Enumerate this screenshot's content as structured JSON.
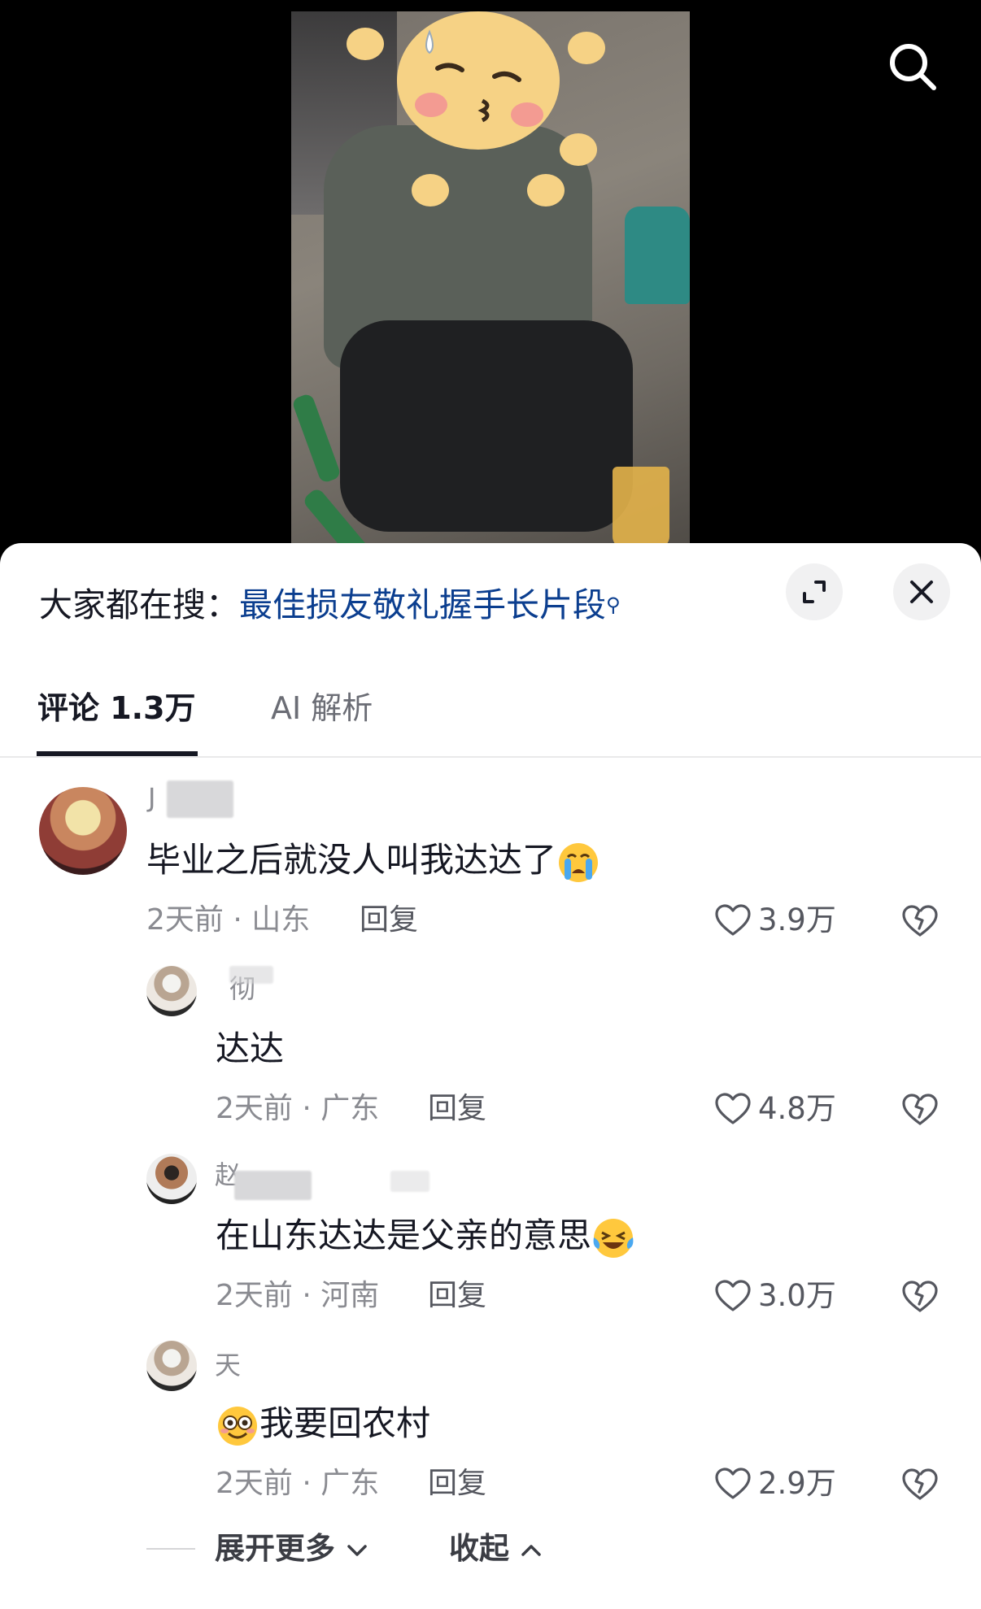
{
  "header": {
    "search_icon": "search-icon"
  },
  "trending_search": {
    "prefix": "大家都在搜：",
    "query": "最佳损友敬礼握手长片段",
    "query_icon": "search-small-icon"
  },
  "sheet_buttons": {
    "expand_icon": "expand-icon",
    "close_icon": "close-icon"
  },
  "tabs": [
    {
      "label": "评论 1.3万",
      "active": true
    },
    {
      "label": "AI 解析",
      "active": false
    }
  ],
  "comments": [
    {
      "username": "J",
      "text": "毕业之后就没人叫我达达了",
      "emoji": "crying-face",
      "time_location": "2天前 · 山东",
      "reply_label": "回复",
      "likes": "3.9万"
    }
  ],
  "replies": [
    {
      "username": "彻",
      "text": "达达",
      "time_location": "2天前 · 广东",
      "reply_label": "回复",
      "likes": "4.8万"
    },
    {
      "username": "赵",
      "text": "在山东达达是父亲的意思",
      "emoji": "laughing-crying-face",
      "time_location": "2天前 · 河南",
      "reply_label": "回复",
      "likes": "3.0万"
    },
    {
      "username": "天",
      "text": "我要回农村",
      "emoji": "flushed-face",
      "time_location": "2天前 · 广东",
      "reply_label": "回复",
      "likes": "2.9万"
    }
  ],
  "footer_actions": {
    "expand_more": "展开更多",
    "collapse": "收起"
  },
  "colors": {
    "link_blue": "#0b3e8f",
    "meta_gray": "#8a8b91",
    "text_dark": "#161823"
  }
}
